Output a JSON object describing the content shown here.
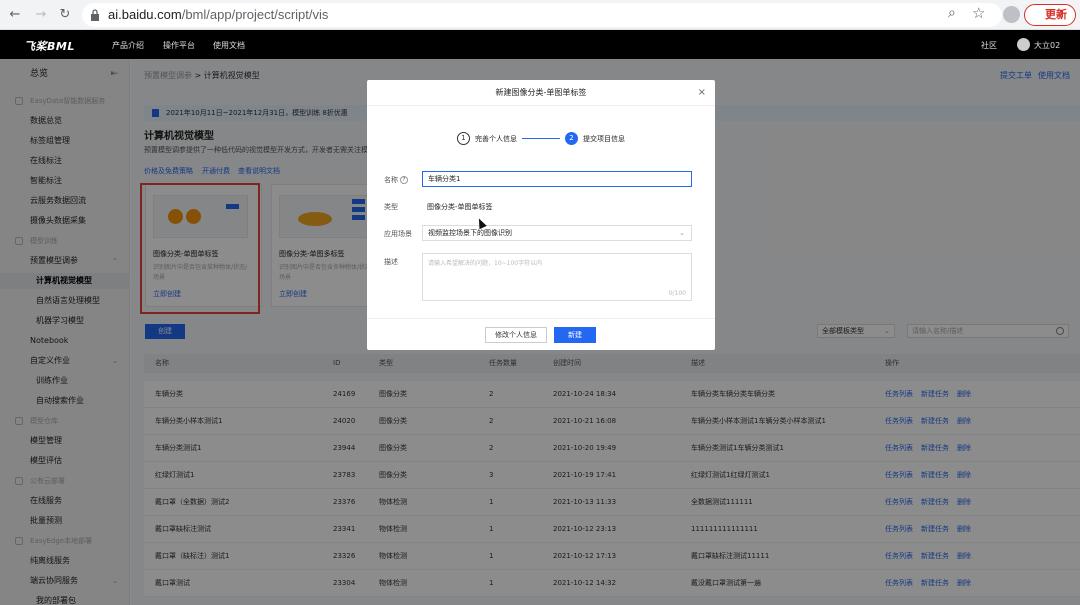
{
  "browser": {
    "url_host": "ai.baidu.com",
    "url_path": "/bml/app/project/script/vis",
    "update_label": "更新"
  },
  "topnav": {
    "logo": "飞桨BML",
    "items": [
      "产品介绍",
      "操作平台",
      "使用文档"
    ],
    "community": "社区",
    "user": "大立02"
  },
  "sidebar": {
    "overview": "总览",
    "items": [
      {
        "label": "EasyData智能数据服务",
        "section": true
      },
      {
        "label": "数据总览"
      },
      {
        "label": "标签组管理"
      },
      {
        "label": "在线标注"
      },
      {
        "label": "智能标注"
      },
      {
        "label": "云服务数据回流"
      },
      {
        "label": "摄像头数据采集"
      },
      {
        "label": "模型训练",
        "section": true
      },
      {
        "label": "预置模型调参",
        "caret": "⌃"
      },
      {
        "label": "计算机视觉模型",
        "active": true
      },
      {
        "label": "自然语言处理模型"
      },
      {
        "label": "机器学习模型"
      },
      {
        "label": "Notebook"
      },
      {
        "label": "自定义作业",
        "caret": "⌄"
      },
      {
        "label": "训练作业"
      },
      {
        "label": "自动搜索作业"
      },
      {
        "label": "模型仓库",
        "section": true
      },
      {
        "label": "模型管理"
      },
      {
        "label": "模型评估"
      },
      {
        "label": "公有云部署",
        "section": true
      },
      {
        "label": "在线服务"
      },
      {
        "label": "批量预测"
      },
      {
        "label": "EasyEdge本地部署",
        "section": true
      },
      {
        "label": "纯离线服务"
      },
      {
        "label": "端云协同服务",
        "caret": "⌄"
      },
      {
        "label": "我的部署包"
      }
    ]
  },
  "main": {
    "breadcrumb_parent": "预置模型调参",
    "breadcrumb_sep": ">",
    "breadcrumb_current": "计算机视觉模型",
    "top_links": [
      "提交工单",
      "使用文档"
    ],
    "notice": "2021年10月11日~2021年12月31日，模型训练 8折优惠",
    "title": "计算机视觉模型",
    "desc": "预置模型调参提供了一种低代码的视觉模型开发方式，开发者无需关注模",
    "links": [
      "价格及免费策略",
      "开通付费",
      "查看说明文档"
    ],
    "cards": [
      {
        "title": "图像分类-单图单标签",
        "desc": "识别图片中是否包含某种物体/状态/场景",
        "action": "立即创建"
      },
      {
        "title": "图像分类-单图多标签",
        "desc": "识别图片中是否包含多种物体/状态/场景",
        "action": "立即创建"
      }
    ],
    "create_button": "创建",
    "filter": "全部模板类型",
    "search_placeholder": "请输入名称/描述",
    "table": {
      "headers": [
        "名称",
        "ID",
        "类型",
        "任务数量",
        "创建时间",
        "描述",
        "操作"
      ],
      "op_labels": [
        "任务列表",
        "新建任务",
        "删除"
      ],
      "rows": [
        [
          "车辆分类",
          "24169",
          "图像分类",
          "2",
          "2021-10-24 18:34",
          "车辆分类车辆分类车辆分类"
        ],
        [
          "车辆分类小样本测试1",
          "24020",
          "图像分类",
          "2",
          "2021-10-21 16:08",
          "车辆分类小样本测试1车辆分类小样本测试1"
        ],
        [
          "车辆分类测试1",
          "23944",
          "图像分类",
          "2",
          "2021-10-20 19:49",
          "车辆分类测试1车辆分类测试1"
        ],
        [
          "红绿灯测试1",
          "23783",
          "图像分类",
          "3",
          "2021-10-19 17:41",
          "红绿灯测试1红绿灯测试1"
        ],
        [
          "戴口罩（全数据）测试2",
          "23376",
          "物体检测",
          "1",
          "2021-10-13 11:33",
          "全数据测试111111"
        ],
        [
          "戴口罩缺标注测试",
          "23341",
          "物体检测",
          "1",
          "2021-10-12 23:13",
          "111111111111111"
        ],
        [
          "戴口罩（缺标注）测试1",
          "23326",
          "物体检测",
          "1",
          "2021-10-12 17:13",
          "戴口罩缺标注测试11111"
        ],
        [
          "戴口罩测试",
          "23304",
          "物体检测",
          "1",
          "2021-10-12 14:32",
          "戴没戴口罩测试第一遍"
        ]
      ]
    }
  },
  "modal": {
    "title": "新建图像分类-单图单标签",
    "close": "×",
    "step1_num": "1",
    "step1": "完善个人信息",
    "step2_num": "2",
    "step2": "提交项目信息",
    "name_label": "名称",
    "name_value": "车辆分类1",
    "type_label": "类型",
    "type_value": "图像分类-单图单标签",
    "scene_label": "应用场景",
    "scene_value": "视频监控场景下的图像识别",
    "desc_label": "描述",
    "desc_placeholder": "请输入希望解决的问题，10~100字符以内",
    "desc_count": "0/100",
    "btn_back": "修改个人信息",
    "btn_create": "新建"
  }
}
